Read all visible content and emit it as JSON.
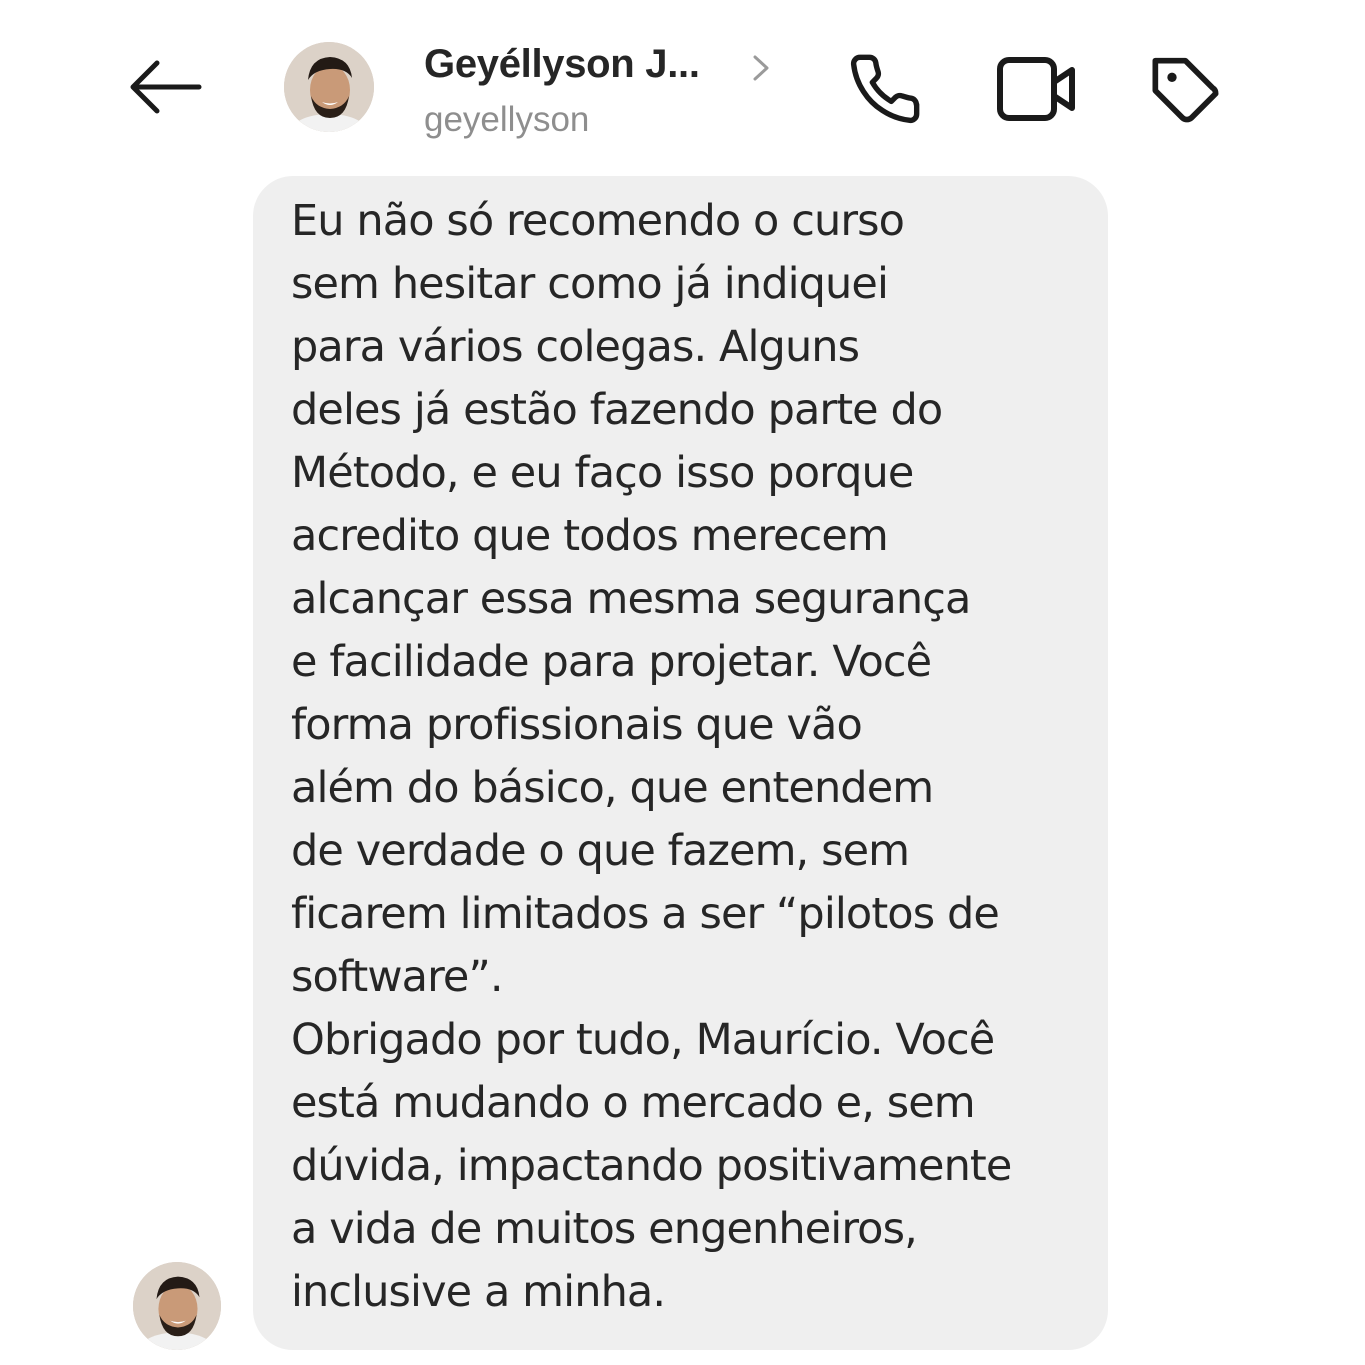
{
  "header": {
    "back_icon": "arrow-left-icon",
    "contact_name": "Geyéllyson J...",
    "contact_username": "geyellyson",
    "icons": {
      "chevron": "chevron-right-icon",
      "phone": "phone-icon",
      "video": "video-camera-icon",
      "tag": "tag-icon"
    }
  },
  "message": {
    "text": "Eu não só recomendo o curso\nsem hesitar como já indiquei\npara vários colegas. Alguns\ndeles já estão fazendo parte do\nMétodo, e eu faço isso porque\nacredito que todos merecem\nalcançar essa mesma segurança\ne facilidade para projetar. Você\nforma profissionais que vão\nalém do básico, que entendem\nde verdade o que fazem, sem\nficarem limitados a ser “pilotos de\nsoftware”.\nObrigado por tudo, Maurício. Você\nestá mudando o mercado e, sem\ndúvida, impactando positivamente\na vida de muitos engenheiros,\ninclusive a minha.",
    "bubble_color": "#efefef"
  },
  "colors": {
    "primary_text": "#262626",
    "secondary_text": "#8e8e8e",
    "icon": "#1a1a1a",
    "background": "#ffffff"
  }
}
